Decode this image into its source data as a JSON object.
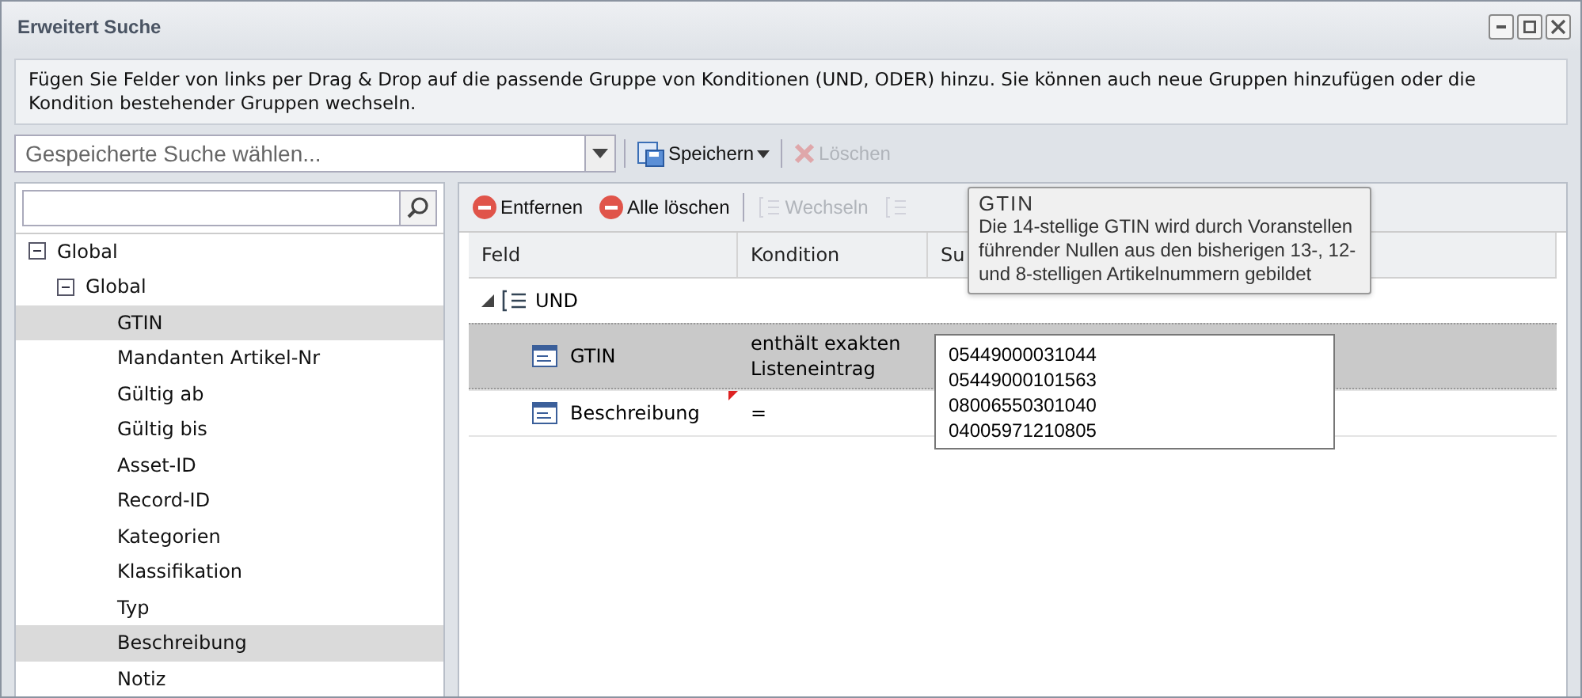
{
  "window": {
    "title": "Erweitert Suche"
  },
  "info": "Fügen Sie Felder von links per Drag & Drop auf die passende Gruppe von Konditionen (UND, ODER) hinzu. Sie können auch neue Gruppen hinzufügen oder die Kondition bestehender Gruppen wechseln.",
  "toolbar": {
    "saved_search": {
      "placeholder": "Gespeicherte Suche wählen..."
    },
    "buttons": [
      {
        "kind": "save",
        "label": "Speichern",
        "disabled": false
      },
      {
        "kind": "delete",
        "label": "Löschen",
        "disabled": true
      }
    ]
  },
  "tree": {
    "label": "Global",
    "expanded": true,
    "children": [
      {
        "label": "Global",
        "expanded": true,
        "children": [
          {
            "label": "GTIN",
            "selected": true
          },
          {
            "label": "Mandanten Artikel-Nr",
            "selected": false
          },
          {
            "label": "Gültig ab",
            "selected": false
          },
          {
            "label": "Gültig bis",
            "selected": false
          },
          {
            "label": "Asset-ID",
            "selected": false
          },
          {
            "label": "Record-ID",
            "selected": false
          },
          {
            "label": "Kategorien",
            "selected": false
          },
          {
            "label": "Klassifikation",
            "selected": false
          },
          {
            "label": "Typ",
            "selected": false
          },
          {
            "label": "Beschreibung",
            "selected": true
          },
          {
            "label": "Notiz",
            "selected": false
          }
        ]
      }
    ]
  },
  "actions": [
    {
      "kind": "remove",
      "label": "Entfernen",
      "disabled": false
    },
    {
      "kind": "remove",
      "label": "Alle löschen",
      "disabled": false
    },
    {
      "kind": "switch",
      "label": "Wechseln",
      "disabled": true
    },
    {
      "kind": "switch",
      "disabled": true
    }
  ],
  "table": {
    "columns": [
      "Feld",
      "Kondition",
      "Su"
    ],
    "group": {
      "label": "UND",
      "expanded": true
    },
    "rows": [
      {
        "field": "GTIN",
        "condition": "enthält exakten Listeneintrag",
        "selected": true,
        "modified": false
      },
      {
        "field": "Beschreibung",
        "condition": "=",
        "selected": false,
        "modified": true
      }
    ]
  },
  "editor": {
    "value": "05449000031044\n05449000101563\n08006550301040\n04005971210805"
  },
  "tooltip": {
    "title": "GTIN",
    "text": "Die 14-stellige GTIN wird durch Voranstellen führender Nullen aus den bisherigen 13-, 12- und 8-stelligen Artikelnummern gebildet"
  }
}
